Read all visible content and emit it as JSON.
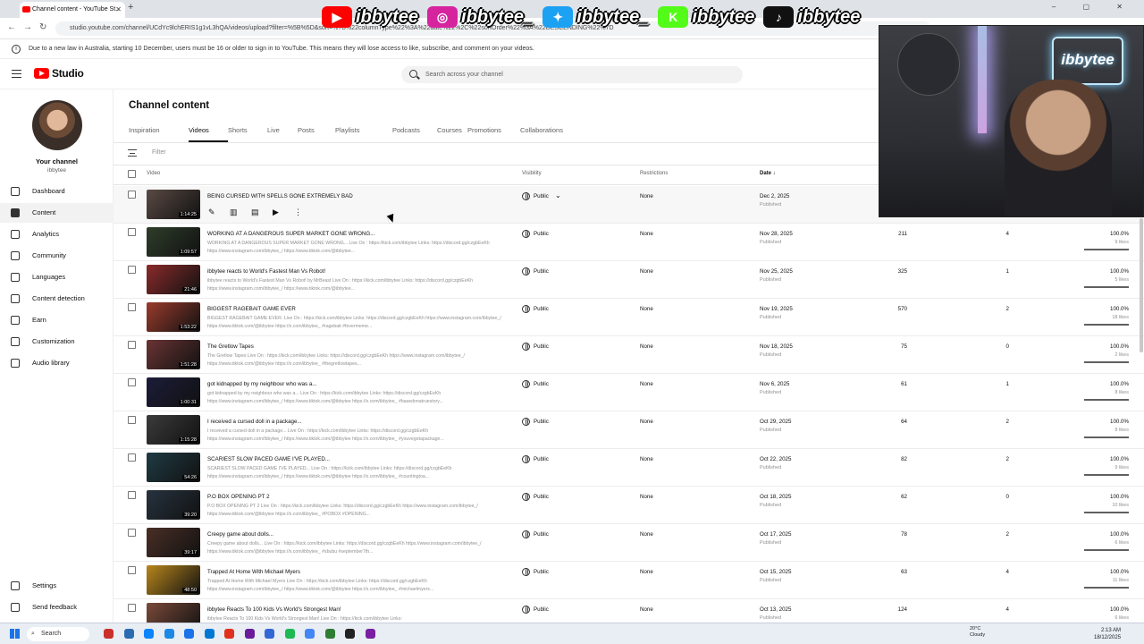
{
  "browser": {
    "tab_title": "Channel content - YouTube St...",
    "url": "studio.youtube.com/channel/UCdYc9lchERIS1g1vL3hQA/videos/upload?filter=%5B%5D&sort=%7B%22columnType%22%3A%22date%22%2C%22sortOrder%22%3A%22DESCENDING%22%7D",
    "new_tab": "+",
    "window_controls": "– ▢ ✕"
  },
  "overlay": {
    "handles": [
      {
        "icon": "youtube-icon",
        "text": "ibbytee",
        "color": "#ff0000"
      },
      {
        "icon": "instagram-icon",
        "text": "ibbytee_",
        "color": "#d6249f"
      },
      {
        "icon": "twitter-icon",
        "text": "ibbytee_",
        "color": "#1da1f2"
      },
      {
        "icon": "kick-icon",
        "text": "ibbytee",
        "color": "#53fc18"
      },
      {
        "icon": "tiktok-icon",
        "text": "ibbytee",
        "color": "#111111"
      }
    ]
  },
  "notice": "Due to a new law in Australia, starting 10 December, users must be 16 or older to sign in to YouTube. This means they will lose access to like, subscribe, and comment on your videos.",
  "header": {
    "logo": "Studio",
    "search_placeholder": "Search across your channel"
  },
  "sidebar": {
    "channel_label": "Your channel",
    "channel_handle": "ibbytee",
    "items": [
      {
        "label": "Dashboard",
        "icon": "dashboard-icon"
      },
      {
        "label": "Content",
        "icon": "content-icon",
        "active": true
      },
      {
        "label": "Analytics",
        "icon": "analytics-icon"
      },
      {
        "label": "Community",
        "icon": "community-icon"
      },
      {
        "label": "Languages",
        "icon": "languages-icon"
      },
      {
        "label": "Content detection",
        "icon": "content-detection-icon"
      },
      {
        "label": "Earn",
        "icon": "earn-icon"
      },
      {
        "label": "Customization",
        "icon": "customization-icon"
      },
      {
        "label": "Audio library",
        "icon": "audio-library-icon"
      }
    ],
    "bottom": [
      {
        "label": "Settings",
        "icon": "gear-icon"
      },
      {
        "label": "Send feedback",
        "icon": "feedback-icon"
      }
    ]
  },
  "main": {
    "title": "Channel content",
    "tabs": [
      "Inspiration",
      "Videos",
      "Shorts",
      "Live",
      "Posts",
      "Playlists",
      "Podcasts",
      "Courses",
      "Promotions",
      "Collaborations"
    ],
    "active_tab": "Videos",
    "filter_placeholder": "Filter",
    "columns": {
      "video": "Video",
      "visibility": "Visibility",
      "restrictions": "Restrictions",
      "date": "Date ↓"
    }
  },
  "videos": [
    {
      "title": "BEING CURSED WITH SPELLS GONE EXTREMELY BAD",
      "desc": "",
      "duration": "1:14:25",
      "visibility": "Public",
      "restrictions": "None",
      "date": "Dec 2, 2025",
      "status": "Published",
      "views": "",
      "comments": "",
      "likes": "",
      "likes_sub": "",
      "like_ratio": 0
    },
    {
      "title": "WORKING AT A DANGEROUS SUPER MARKET GONE WRONG...",
      "desc": "WORKING AT A DANGEROUS SUPER MARKET GONE WRONG... Live On : https://kick.com/ibbytee Links: https://discord.gg/czgbEeKh https://www.instagram.com/ibbytee_/ https://www.tiktok.com/@ibbytee...",
      "duration": "1:09:57",
      "visibility": "Public",
      "restrictions": "None",
      "date": "Nov 28, 2025",
      "status": "Published",
      "views": "211",
      "comments": "4",
      "likes": "100.0%",
      "likes_sub": "9 likes",
      "like_ratio": 1.0
    },
    {
      "title": "ibbytee reacts to World's Fastest Man Vs Robot!",
      "desc": "ibbytee reacts to World's Fastest Man Vs Robot! by MrBeast Live On : https://kick.com/ibbytee Links: https://discord.gg/czgbEeKh https://www.instagram.com/ibbytee_/ https://www.tiktok.com/@ibbytee...",
      "duration": "21:46",
      "visibility": "Public",
      "restrictions": "None",
      "date": "Nov 25, 2025",
      "status": "Published",
      "views": "325",
      "comments": "1",
      "likes": "100.0%",
      "likes_sub": "5 likes",
      "like_ratio": 1.0
    },
    {
      "title": "BIGGEST RAGEBAIT GAME EVER",
      "desc": "BIGGEST RAGEBAIT GAME EVER. Live On : https://kick.com/ibbytee Links: https://discord.gg/czgbEeKh https://www.instagram.com/ibbytee_/ https://www.tiktok.com/@ibbytee https://x.com/ibbytee_ #ragebait #fevermeme...",
      "duration": "1:53:22",
      "visibility": "Public",
      "restrictions": "None",
      "date": "Nov 19, 2025",
      "status": "Published",
      "views": "570",
      "comments": "2",
      "likes": "100.0%",
      "likes_sub": "18 likes",
      "like_ratio": 1.0
    },
    {
      "title": "The Gretlow Tapes",
      "desc": "The Gretlow Tapes Live On : https://kick.com/ibbytee Links: https://discord.gg/czgbEeKh https://www.instagram.com/ibbytee_/ https://www.tiktok.com/@ibbytee https://x.com/ibbytee_ #thegretlowtapes...",
      "duration": "1:51:28",
      "visibility": "Public",
      "restrictions": "None",
      "date": "Nov 18, 2025",
      "status": "Published",
      "views": "75",
      "comments": "0",
      "likes": "100.0%",
      "likes_sub": "2 likes",
      "like_ratio": 1.0
    },
    {
      "title": "got kidnapped by my neighbour who was a...",
      "desc": "got kidnapped by my neighbour who was a... Live On : https://kick.com/ibbytee Links: https://discord.gg/czgbEeKh https://www.instagram.com/ibbytee_/ https://www.tiktok.com/@ibbytee https://x.com/ibbytee_ #basedonatruestory...",
      "duration": "1:00:31",
      "visibility": "Public",
      "restrictions": "None",
      "date": "Nov 6, 2025",
      "status": "Published",
      "views": "61",
      "comments": "1",
      "likes": "100.0%",
      "likes_sub": "8 likes",
      "like_ratio": 1.0
    },
    {
      "title": "I received a cursed doll in a package...",
      "desc": "I received a cursed doll in a package... Live On : https://kick.com/ibbytee Links: https://discord.gg/czgbEeKh https://www.instagram.com/ibbytee_/ https://www.tiktok.com/@ibbytee https://x.com/ibbytee_ #youvegotapackage...",
      "duration": "1:15:28",
      "visibility": "Public",
      "restrictions": "None",
      "date": "Oct 29, 2025",
      "status": "Published",
      "views": "64",
      "comments": "2",
      "likes": "100.0%",
      "likes_sub": "8 likes",
      "like_ratio": 1.0
    },
    {
      "title": "SCARIEST SLOW PACED GAME I'VE PLAYED...",
      "desc": "SCARIEST SLOW PACED GAME I'VE PLAYED... Live On : https://kick.com/ibbytee Links: https://discord.gg/czgbEeKh https://www.instagram.com/ibbytee_/ https://www.tiktok.com/@ibbytee https://x.com/ibbytee_ #countingtoa...",
      "duration": "54:26",
      "visibility": "Public",
      "restrictions": "None",
      "date": "Oct 22, 2025",
      "status": "Published",
      "views": "82",
      "comments": "2",
      "likes": "100.0%",
      "likes_sub": "9 likes",
      "like_ratio": 1.0
    },
    {
      "title": "P.O BOX OPENING PT 2",
      "desc": "P.O BOX OPENING PT 2 Live On : https://kick.com/ibbytee Links: https://discord.gg/czgbEeKh https://www.instagram.com/ibbytee_/ https://www.tiktok.com/@ibbytee https://x.com/ibbytee_ #POBOX #OPENING...",
      "duration": "39:20",
      "visibility": "Public",
      "restrictions": "None",
      "date": "Oct 18, 2025",
      "status": "Published",
      "views": "62",
      "comments": "0",
      "likes": "100.0%",
      "likes_sub": "10 likes",
      "like_ratio": 1.0
    },
    {
      "title": "Creepy game about dolls...",
      "desc": "Creepy game about dolls... Live On : https://kick.com/ibbytee Links: https://discord.gg/czgbEeKh https://www.instagram.com/ibbytee_/ https://www.tiktok.com/@ibbytee https://x.com/ibbytee_ #sbubu #september7th...",
      "duration": "39:17",
      "visibility": "Public",
      "restrictions": "None",
      "date": "Oct 17, 2025",
      "status": "Published",
      "views": "78",
      "comments": "2",
      "likes": "100.0%",
      "likes_sub": "6 likes",
      "like_ratio": 1.0
    },
    {
      "title": "Trapped At Home With Michael Myers",
      "desc": "Trapped At Home With Michael Myers Live On : https://kick.com/ibbytee Links: https://discord.gg/czgbEeKh https://www.instagram.com/ibbytee_/ https://www.tiktok.com/@ibbytee https://x.com/ibbytee_ #michaelmyers...",
      "duration": "48:50",
      "visibility": "Public",
      "restrictions": "None",
      "date": "Oct 15, 2025",
      "status": "Published",
      "views": "63",
      "comments": "4",
      "likes": "100.0%",
      "likes_sub": "11 likes",
      "like_ratio": 1.0
    },
    {
      "title": "ibbytee Reacts To 100 Kids Vs World's Strongest Man!",
      "desc": "ibbytee Reacts To 100 Kids Vs World's Strongest Man! Live On : https://kick.com/ibbytee Links:",
      "duration": "",
      "visibility": "Public",
      "restrictions": "None",
      "date": "Oct 13, 2025",
      "status": "Published",
      "views": "124",
      "comments": "4",
      "likes": "100.0%",
      "likes_sub": "6 likes",
      "like_ratio": 1.0
    }
  ],
  "row_actions": [
    "edit-icon",
    "analytics-icon",
    "comments-icon",
    "youtube-icon",
    "more-icon"
  ],
  "taskbar": {
    "search": "Search",
    "weather_temp": "20°C",
    "weather_desc": "Cloudy",
    "time": "2:13 AM",
    "date": "18/12/2025"
  },
  "colors": {
    "accent": "#0f0f0f",
    "youtube_red": "#ff0000",
    "taskbar": "#e8eef4"
  }
}
